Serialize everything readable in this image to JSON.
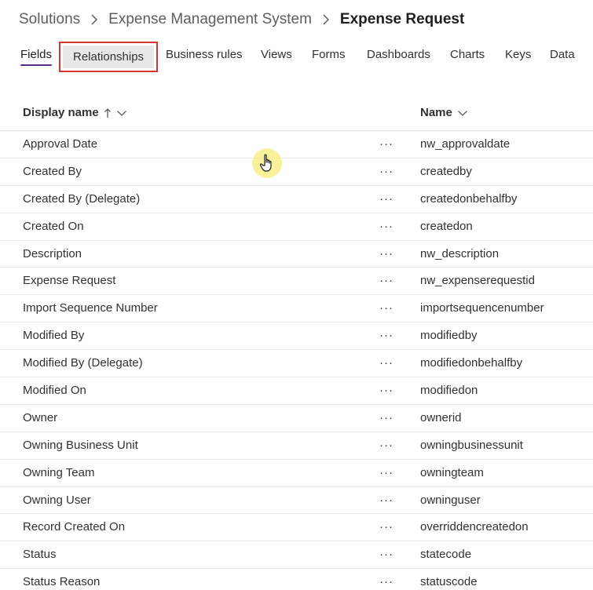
{
  "breadcrumb": {
    "items": [
      "Solutions",
      "Expense Management System"
    ],
    "current": "Expense Request"
  },
  "tabs": [
    {
      "label": "Fields",
      "active": true
    },
    {
      "label": "Relationships",
      "highlighted": true
    },
    {
      "label": "Business rules"
    },
    {
      "label": "Views"
    },
    {
      "label": "Forms"
    },
    {
      "label": "Dashboards"
    },
    {
      "label": "Charts"
    },
    {
      "label": "Keys"
    },
    {
      "label": "Data"
    }
  ],
  "table": {
    "columns": {
      "display_name": "Display name",
      "name": "Name"
    },
    "more_label": "···",
    "rows": [
      {
        "display": "Approval Date",
        "name": "nw_approvaldate"
      },
      {
        "display": "Created By",
        "name": "createdby"
      },
      {
        "display": "Created By (Delegate)",
        "name": "createdonbehalfby"
      },
      {
        "display": "Created On",
        "name": "createdon"
      },
      {
        "display": "Description",
        "name": "nw_description"
      },
      {
        "display": "Expense Request",
        "name": "nw_expenserequestid"
      },
      {
        "display": "Import Sequence Number",
        "name": "importsequencenumber"
      },
      {
        "display": "Modified By",
        "name": "modifiedby"
      },
      {
        "display": "Modified By (Delegate)",
        "name": "modifiedonbehalfby"
      },
      {
        "display": "Modified On",
        "name": "modifiedon"
      },
      {
        "display": "Owner",
        "name": "ownerid"
      },
      {
        "display": "Owning Business Unit",
        "name": "owningbusinessunit"
      },
      {
        "display": "Owning Team",
        "name": "owningteam"
      },
      {
        "display": "Owning User",
        "name": "owninguser"
      },
      {
        "display": "Record Created On",
        "name": "overriddencreatedon"
      },
      {
        "display": "Status",
        "name": "statecode"
      },
      {
        "display": "Status Reason",
        "name": "statuscode"
      }
    ]
  },
  "colors": {
    "active_tab_underline": "#5b2e82",
    "highlight_border": "#d7372f",
    "cursor_halo": "#f5ee78"
  },
  "icons": {
    "breadcrumb_separator": "chevron-right-icon",
    "sort": "arrow-up-icon",
    "column_menu": "chevron-down-icon",
    "row_menu": "more-icon",
    "cursor": "hand-pointer-icon"
  }
}
